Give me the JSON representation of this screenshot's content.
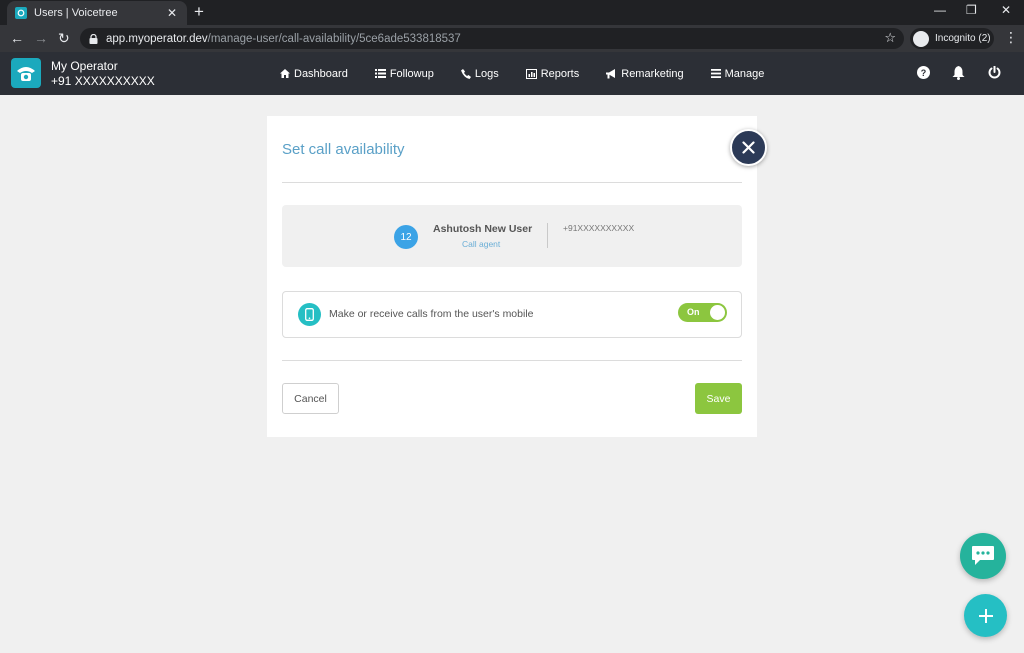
{
  "browser": {
    "tab_title": "Users | Voicetree",
    "url_host": "app.myoperator.dev",
    "url_path": "/manage-user/call-availability/5ce6ade533818537",
    "incognito_label": "Incognito (2)"
  },
  "header": {
    "brand_name": "My Operator",
    "brand_phone": "+91  XXXXXXXXXX",
    "nav": [
      {
        "label": "Dashboard",
        "icon": "home-icon"
      },
      {
        "label": "Followup",
        "icon": "list-icon"
      },
      {
        "label": "Logs",
        "icon": "phone-icon"
      },
      {
        "label": "Reports",
        "icon": "chart-icon"
      },
      {
        "label": "Remarketing",
        "icon": "megaphone-icon"
      },
      {
        "label": "Manage",
        "icon": "menu-icon"
      }
    ]
  },
  "modal": {
    "title": "Set call availability",
    "user": {
      "badge": "12",
      "name": "Ashutosh New User",
      "role": "Call agent",
      "phone": "+91XXXXXXXXXX"
    },
    "mobile_option": {
      "label": "Make or receive calls from the user's mobile",
      "toggle_label": "On",
      "enabled": true
    },
    "cancel_label": "Cancel",
    "save_label": "Save"
  },
  "colors": {
    "accent": "#1ba9bd",
    "header_bg": "#2c2f36",
    "title": "#5aa0c7",
    "save": "#8cc63f",
    "toggle_on": "#8cc63f",
    "chat_fab": "#25b39c",
    "add_fab": "#25bfc4"
  }
}
